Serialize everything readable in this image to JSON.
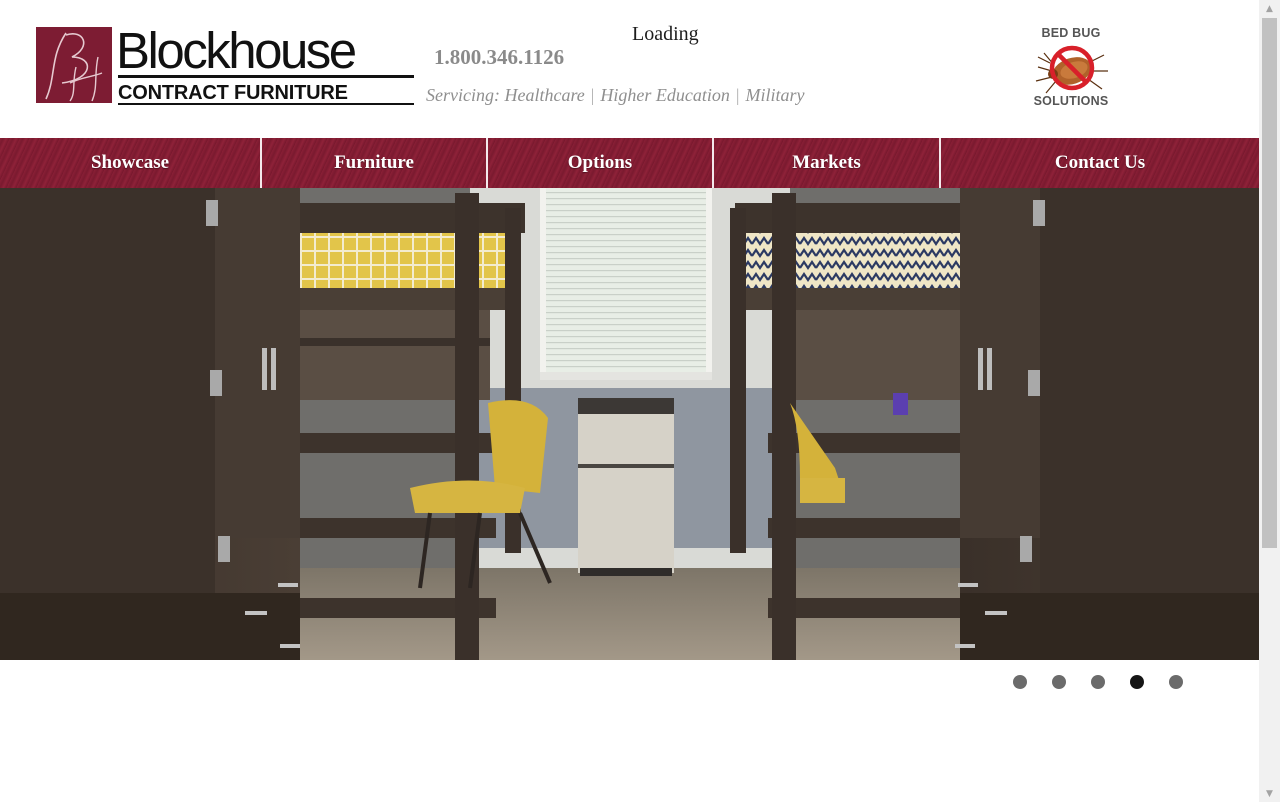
{
  "header": {
    "logo_text": "Blockhouse",
    "logo_subtext": "CONTRACT FURNITURE",
    "logo_monogram": "BH",
    "phone": "1.800.346.1126",
    "servicing_prefix": "Servicing:",
    "markets": [
      "Healthcare",
      "Higher Education",
      "Military"
    ],
    "loading": "Loading",
    "badge": {
      "top": "BED BUG",
      "bottom": "SOLUTIONS",
      "icon": "bed-bug-prohibited-icon"
    }
  },
  "nav": [
    {
      "label": "Showcase"
    },
    {
      "label": "Furniture"
    },
    {
      "label": "Options"
    },
    {
      "label": "Markets"
    },
    {
      "label": "Contact Us"
    }
  ],
  "slider": {
    "slide_count": 5,
    "active_index": 4,
    "image": "dorm-room-loft-beds-photo"
  },
  "colors": {
    "brand": "#7d1c33",
    "nav": "#8a1f36",
    "dot": "#6b6b6b",
    "dot_active": "#151515",
    "text_gray": "#8a8a8a"
  }
}
